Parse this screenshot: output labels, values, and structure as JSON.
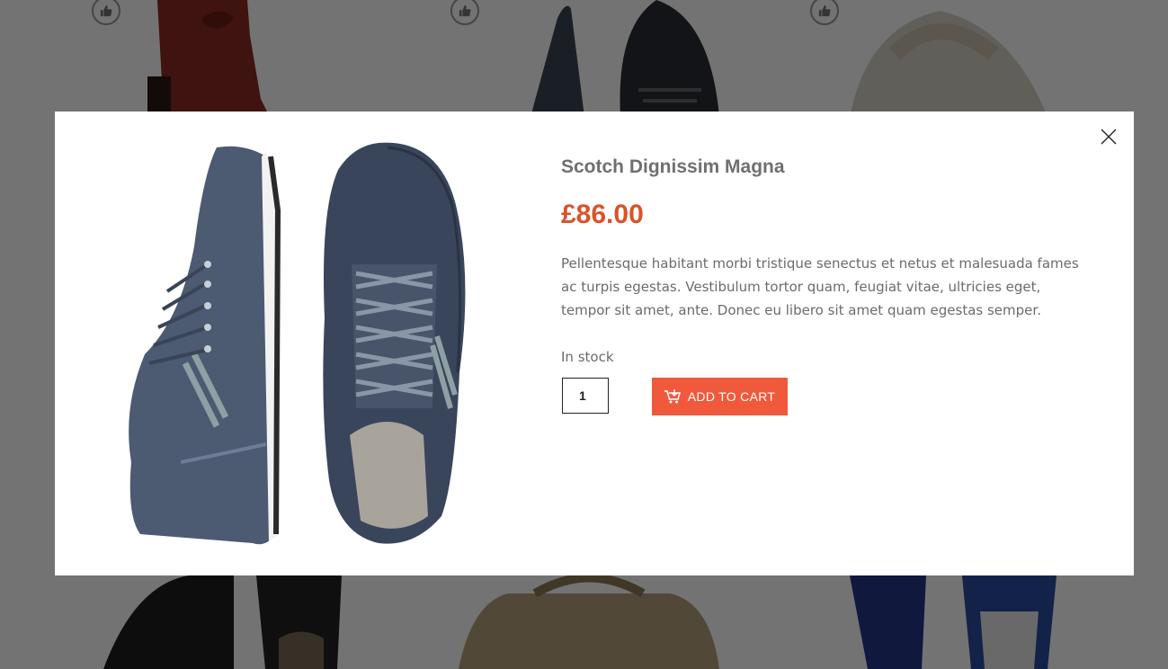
{
  "product": {
    "title": "Scotch Dignissim Magna",
    "price": "£86.00",
    "description": "Pellentesque habitant morbi tristique senectus et netus et malesuada fames ac turpis egestas. Vestibulum tortor quam, feugiat vitae, ultricies eget, tempor sit amet, ante. Donec eu libero sit amet quam egestas semper.",
    "stock_status": "In stock",
    "quantity": "1",
    "add_to_cart_label": "ADD TO CART"
  },
  "icons": {
    "close": "close-icon",
    "cart": "cart-icon",
    "like": "thumbs-up-icon"
  },
  "colors": {
    "price": "#d9532a",
    "button": "#f0593b",
    "overlay": "rgba(0,0,0,0.55)"
  }
}
